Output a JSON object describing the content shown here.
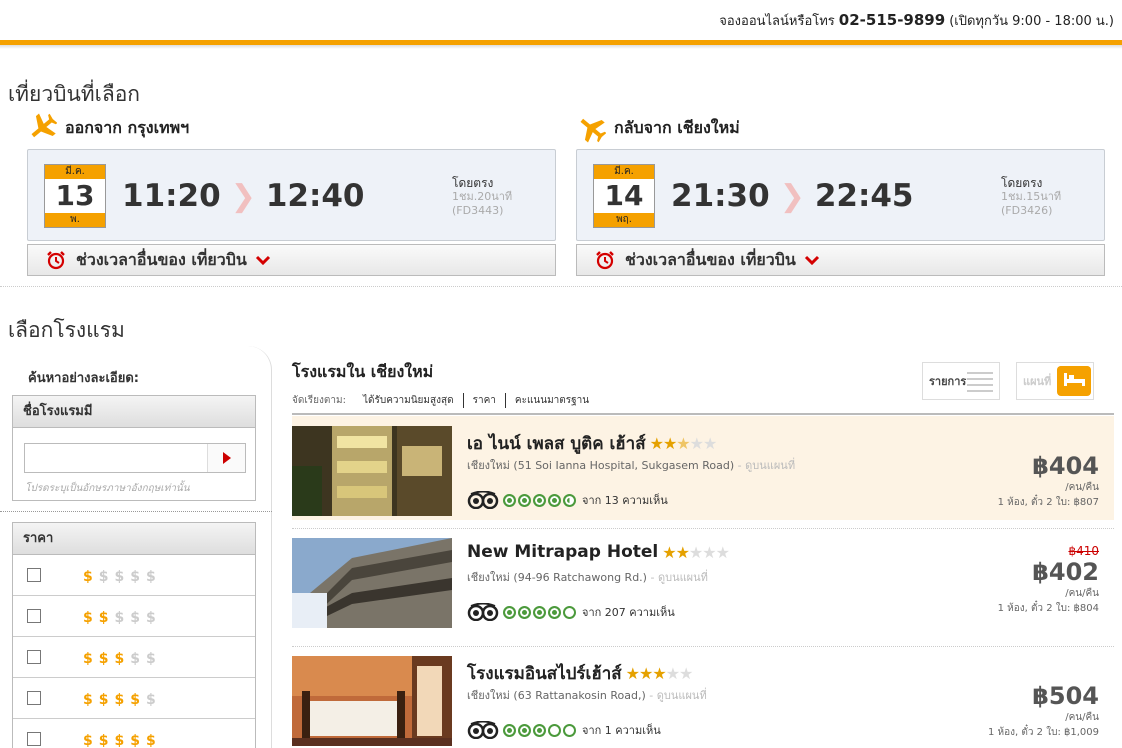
{
  "header": {
    "booking_text": "จองออนไลน์หรือโทร",
    "phone": "02-515-9899",
    "hours": "(เปิดทุกวัน 9:00 - 18:00 น.)"
  },
  "flights": {
    "section_title": "เที่ยวบินที่เลือก",
    "outbound": {
      "title": "ออกจาก กรุงเทพฯ",
      "month": "มี.ค.",
      "day": "13",
      "weekday": "พ.",
      "depart": "11:20",
      "arrive": "12:40",
      "direct": "โดยตรง",
      "duration": "1ชม.20นาที",
      "code": "(FD3443)",
      "other_times": "ช่วงเวลาอื่นของ เที่ยวบิน"
    },
    "inbound": {
      "title": "กลับจาก เชียงใหม่",
      "month": "มี.ค.",
      "day": "14",
      "weekday": "พฤ.",
      "depart": "21:30",
      "arrive": "22:45",
      "direct": "โดยตรง",
      "duration": "1ชม.15นาที",
      "code": "(FD3426)",
      "other_times": "ช่วงเวลาอื่นของ เที่ยวบิน"
    },
    "arrow": "❯"
  },
  "hotels": {
    "section_title": "เลือกโรงแรม",
    "filter": {
      "title": "ค้นหาอย่างละเอียด:",
      "name_header": "ชื่อโรงแรมมี",
      "name_value": "",
      "name_hint": "โปรดระบุเป็นอักษรภาษาอังกฤษเท่านั้น",
      "price_header": "ราคา",
      "price_levels": [
        1,
        2,
        3,
        4,
        5
      ]
    },
    "results": {
      "title": "โรงแรมใน เชียงใหม่",
      "sort_label": "จัดเรียงตาม:",
      "sort_options": [
        "ได้รับความนิยมสูงสุด",
        "ราคา",
        "คะแนนมาตรฐาน"
      ],
      "view_list": "รายการ",
      "view_map": "แผนที่"
    },
    "list": [
      {
        "name": "เอ ไนน์ เพลส บูติค เฮ้าส์",
        "stars": 2.5,
        "address": "เชียงใหม่ (51 Soi Ianna Hospital, Sukgasem Road)",
        "map_link": "- ดูบนแผนที่",
        "reviews": "จาก 13 ความเห็น",
        "bubbles": 4.5,
        "old_price": "",
        "price": "฿404",
        "per": "/คน/คืน",
        "sub": "1 ห้อง, ตั๋ว 2 ใบ: ฿807",
        "highlight": true
      },
      {
        "name": "New Mitrapap Hotel",
        "stars": 2,
        "address": "เชียงใหม่ (94-96 Ratchawong Rd.)",
        "map_link": "- ดูบนแผนที่",
        "reviews": "จาก 207 ความเห็น",
        "bubbles": 4,
        "old_price": "฿410",
        "price": "฿402",
        "per": "/คน/คืน",
        "sub": "1 ห้อง, ตั๋ว 2 ใบ: ฿804",
        "highlight": false
      },
      {
        "name": "โรงแรมอินสไปร์เฮ้าส์",
        "stars": 3,
        "address": "เชียงใหม่ (63 Rattanakosin Road,)",
        "map_link": "- ดูบนแผนที่",
        "reviews": "จาก 1 ความเห็น",
        "bubbles": 3,
        "old_price": "",
        "price": "฿504",
        "per": "/คน/คืน",
        "sub": "1 ห้อง, ตั๋ว 2 ใบ: ฿1,009",
        "highlight": false
      }
    ]
  },
  "colors": {
    "accent": "#f5a100",
    "tripadvisor_green": "#4c9a3c",
    "strike_red": "#cc0000"
  }
}
